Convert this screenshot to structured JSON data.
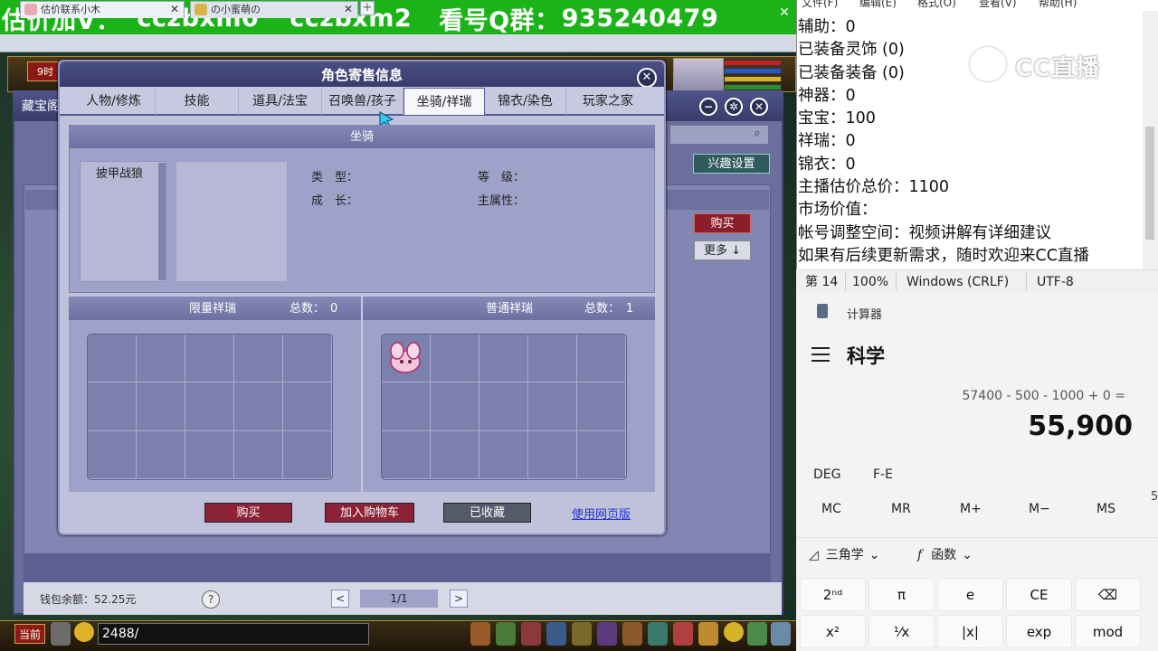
{
  "stream_banner": {
    "label": "估价加V：",
    "contact1": "cczbxm0",
    "contact2": "cczbxm2",
    "qq_label": "看号Q群：",
    "qq_number": "935240479",
    "close": "✕"
  },
  "browser_tabs": [
    {
      "label": "估价联系小木",
      "close": "✕"
    },
    {
      "label": "の小蜜萌の",
      "close": "✕"
    }
  ],
  "browser_new_tab": "+",
  "game_hud": {
    "left_tag": "9时",
    "now_tag": "当前",
    "chat_input": "2488/"
  },
  "back_panel": {
    "title": "藏宝阁",
    "interest_button": "兴趣设置",
    "buy_button": "购买",
    "more_button": "更多 ↓",
    "wallet_label": "钱包余额：52.25元",
    "help": "?",
    "prev": "<",
    "next": ">",
    "page": "1/1"
  },
  "dialog": {
    "title": "角色寄售信息",
    "close": "✕",
    "tabs": [
      {
        "label": "人物/修炼",
        "active": false
      },
      {
        "label": "技能",
        "active": false
      },
      {
        "label": "道具/法宝",
        "active": false
      },
      {
        "label": "召唤兽/孩子",
        "active": false
      },
      {
        "label": "坐骑/祥瑞",
        "active": true
      },
      {
        "label": "锦衣/染色",
        "active": false
      },
      {
        "label": "玩家之家",
        "active": false
      }
    ],
    "mount_section": {
      "header": "坐骑",
      "items": [
        "披甲战狼"
      ],
      "type_label": "类　型：",
      "level_label": "等　级：",
      "growth_label": "成　长：",
      "attr_label": "主属性："
    },
    "limited_auspicious": {
      "header": "限量祥瑞",
      "total_label": "总数：",
      "total": "0"
    },
    "normal_auspicious": {
      "header": "普通祥瑞",
      "total_label": "总数：",
      "total": "1"
    },
    "buttons": {
      "buy": "购买",
      "add_cart": "加入购物车",
      "collected": "已收藏",
      "web_version": "使用网页版"
    }
  },
  "notepad": {
    "menu": [
      "文件(F)",
      "编辑(E)",
      "格式(O)",
      "查看(V)",
      "帮助(H)"
    ],
    "lines": [
      "辅助：0",
      "已装备灵饰 (0)",
      "已装备装备 (0)",
      "神器：0",
      "宝宝：100",
      "祥瑞：0",
      "锦衣：0",
      "主播估价总价：1100",
      "市场价值：",
      "帐号调整空间：视频讲解有详细建议",
      "如果有后续更新需求，随时欢迎来CC直播"
    ],
    "watermark": "CC直播",
    "status": {
      "line": "第 14",
      "zoom": "100%",
      "eol": "Windows (CRLF)",
      "encoding": "UTF-8"
    }
  },
  "calculator": {
    "app_title": "计算器",
    "mode": "科学",
    "expression": "57400 - 500 - 1000 + 0 =",
    "result": "55,900",
    "fn_row": [
      "DEG",
      "F-E"
    ],
    "memory_row": [
      "MC",
      "MR",
      "M+",
      "M−",
      "MS"
    ],
    "edge_digit": "5",
    "dropdowns": [
      "三角学",
      "函数"
    ],
    "keys_row1": [
      "2ⁿᵈ",
      "π",
      "e",
      "CE",
      "⌫"
    ],
    "keys_row2": [
      "x²",
      "¹⁄x",
      "|x|",
      "exp",
      "mod"
    ]
  }
}
